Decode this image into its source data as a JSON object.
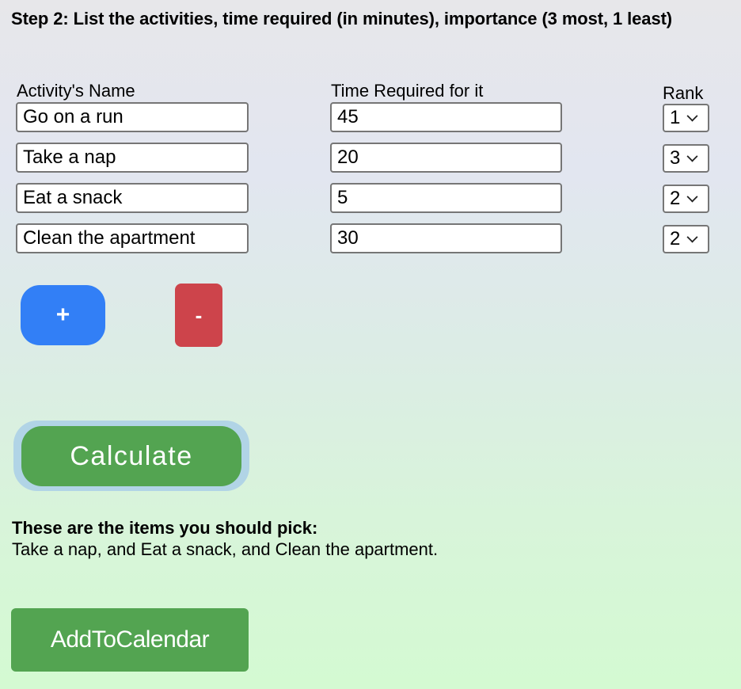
{
  "heading": "Step 2: List the activities, time required (in minutes), importance (3 most, 1 least)",
  "columns": {
    "name": "Activity's Name",
    "time": "Time Required for it",
    "rank": "Rank"
  },
  "activities": [
    {
      "name": "Go on a run",
      "time": "45",
      "rank": "1"
    },
    {
      "name": "Take a nap",
      "time": "20",
      "rank": "3"
    },
    {
      "name": "Eat a snack",
      "time": "5",
      "rank": "2"
    },
    {
      "name": "Clean the apartment",
      "time": "30",
      "rank": "2"
    }
  ],
  "buttons": {
    "add_row": "+",
    "remove_row": "-",
    "calculate": "Calculate",
    "add_to_calendar": "AddToCalendar"
  },
  "result": {
    "title": "These are the items you should pick:",
    "text": "Take a nap, and Eat a snack, and Clean the apartment."
  },
  "colors": {
    "add_button": "#327ff6",
    "remove_button": "#cd444b",
    "calculate_button": "#53a451",
    "calculate_focus_ring": "#b1d4e6",
    "calendar_button": "#53a451"
  }
}
